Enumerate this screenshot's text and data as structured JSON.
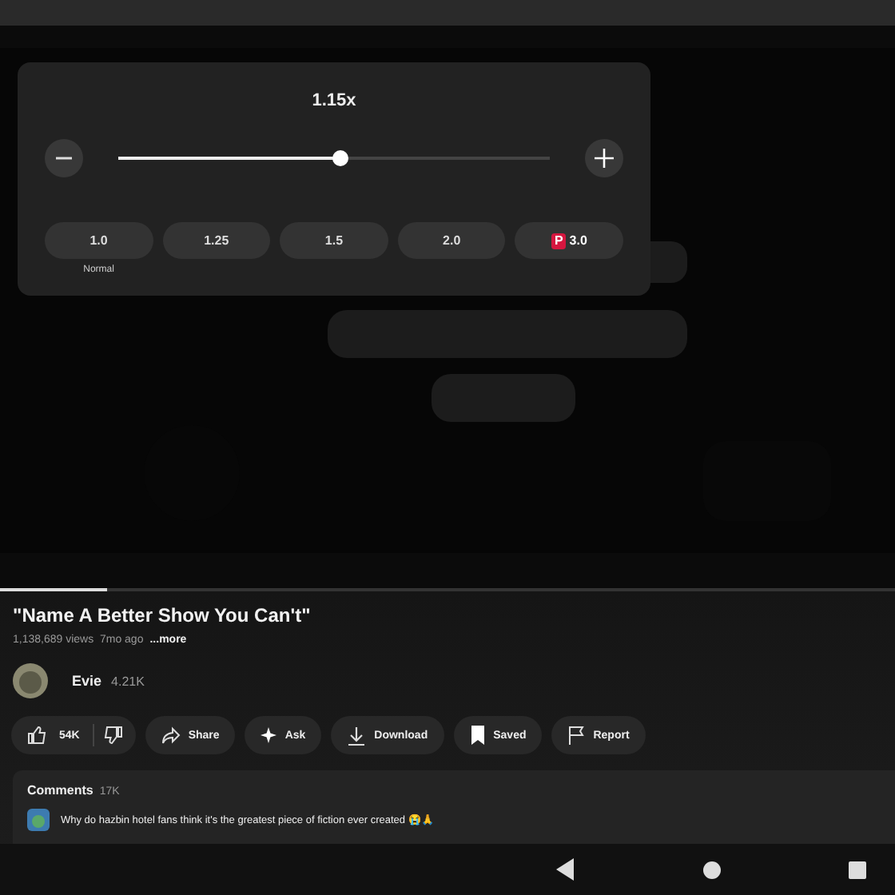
{
  "speed_panel": {
    "speed": "1.15x",
    "slider": {
      "level": 0.515
    },
    "presets": [
      {
        "label": "1.0",
        "caption": "Normal",
        "premium": false
      },
      {
        "label": "1.25",
        "premium": false
      },
      {
        "label": "1.5",
        "premium": false
      },
      {
        "label": "2.0",
        "premium": false
      },
      {
        "label": "3.0",
        "premium": true,
        "badge": "P"
      }
    ]
  },
  "video": {
    "progress": {
      "level": 0.12
    }
  },
  "title": "\"Name A Better Show You Can't\"",
  "meta": {
    "stats": "1,138,689 views  7mo ago",
    "more": "...more"
  },
  "channel": {
    "name": "Evie",
    "subscribers": "4.21K"
  },
  "actions": [
    {
      "kind": "like",
      "label": "54K"
    },
    {
      "kind": "share",
      "label": "Share"
    },
    {
      "kind": "ask",
      "label": "Ask"
    },
    {
      "kind": "download",
      "label": "Download"
    },
    {
      "kind": "saved",
      "label": "Saved"
    },
    {
      "kind": "report",
      "label": "Report"
    }
  ],
  "comments": {
    "title": "Comments",
    "count": "17K",
    "top_comment": "Why do hazbin hotel fans think it's the greatest piece of fiction ever created 😭🙏"
  }
}
